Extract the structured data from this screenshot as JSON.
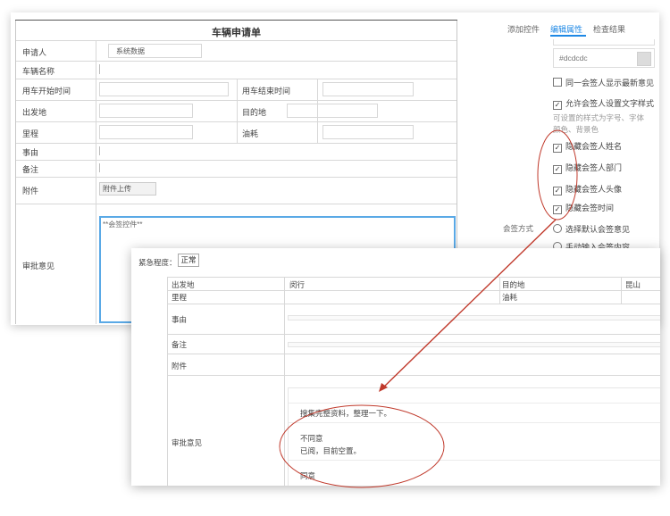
{
  "form": {
    "title": "车辆申请单",
    "applicant_label": "申请人",
    "applicant_value": "系统数据",
    "vehicle_name_label": "车辆名称",
    "start_time_label": "用车开始时间",
    "end_time_label": "用车结束时间",
    "origin_label": "出发地",
    "destination_label": "目的地",
    "mileage_label": "里程",
    "fuel_label": "油耗",
    "reason_label": "事由",
    "remark_label": "备注",
    "attachment_label": "附件",
    "attachment_button": "附件上传",
    "approval_label": "审批意见",
    "approval_placeholder": "**会签控件**"
  },
  "panel": {
    "tabs": [
      "添加控件",
      "编辑属性",
      "检查结果"
    ],
    "color_value": "#dcdcdc",
    "options": [
      {
        "label": "同一会签人显示最新意见",
        "checked": false
      },
      {
        "label": "允许会签人设置文字样式",
        "checked": true
      }
    ],
    "note_line1": "可设置的样式为字号、字体",
    "note_line2": "颜色、背景色",
    "hide_options": [
      {
        "label": "隐藏会签人姓名",
        "checked": true
      },
      {
        "label": "隐藏会签人部门",
        "checked": true
      },
      {
        "label": "隐藏会签人头像",
        "checked": true
      },
      {
        "label": "隐藏会签时间",
        "checked": true
      }
    ],
    "mode_label": "会签方式",
    "mode_option1": "选择默认会签意见",
    "mode_option2": "手动输入会签内容"
  },
  "preview": {
    "urgency_label": "紧急程度：",
    "urgency_value": "正常",
    "origin_label": "出发地",
    "origin_value": "闵行",
    "destination_label": "目的地",
    "destination_value": "昆山",
    "mileage_label": "里程",
    "fuel_label": "油耗",
    "reason_label": "事由",
    "remark_label": "备注",
    "attachment_label": "附件",
    "approval_label": "审批意见",
    "opinion1": "搜集完整资料，整理一下。",
    "opinion2_title": "不同意",
    "opinion2_text": "已阅，目前空置。",
    "opinion3_title": "同意"
  },
  "colors": {
    "accent": "#1e88e5",
    "annotation": "#c0392b"
  }
}
